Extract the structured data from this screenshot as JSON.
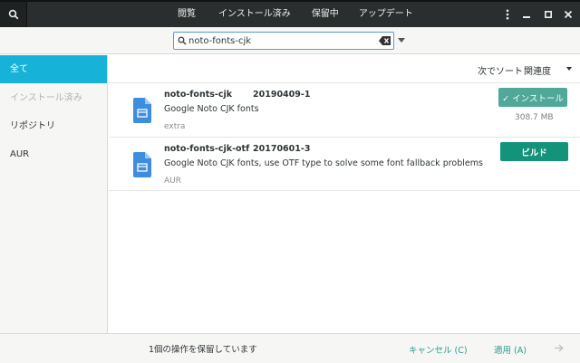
{
  "header": {
    "tabs": [
      {
        "label": "閲覧"
      },
      {
        "label": "インストール済み"
      },
      {
        "label": "保留中"
      },
      {
        "label": "アップデート"
      }
    ],
    "search_toggle_icon": "search-icon",
    "menu_icon": "vertical-dots-icon",
    "window_controls": [
      "minimize-icon",
      "maximize-icon",
      "close-icon"
    ]
  },
  "search": {
    "value": "noto-fonts-cjk",
    "placeholder": ""
  },
  "sidebar": {
    "items": [
      {
        "label": "全て",
        "state": "active"
      },
      {
        "label": "インストール済み",
        "state": "disabled"
      },
      {
        "label": "リポジトリ",
        "state": "normal"
      },
      {
        "label": "AUR",
        "state": "normal"
      }
    ]
  },
  "sort": {
    "label": "次でソート",
    "selected": "関連度"
  },
  "packages": [
    {
      "name": "noto-fonts-cjk",
      "version": "20190409-1",
      "description": "Google Noto CJK fonts",
      "repo": "extra",
      "action": "✓ インストール",
      "size": "308.7 MB"
    },
    {
      "name": "noto-fonts-cjk-otf",
      "version": "20170601-3",
      "description": "Google Noto CJK fonts, use OTF type to solve some font fallback problems",
      "repo": "AUR",
      "action": "ビルド",
      "size": ""
    }
  ],
  "footer": {
    "pending_text": "1個の操作を保留しています",
    "cancel_label": "キャンセル (C)",
    "apply_label": "適用 (A)"
  },
  "colors": {
    "header_bg": "#2b2e2f",
    "accent_blue": "#17b2d8",
    "action_green": "#14937b",
    "link_teal": "#2a9d8f"
  }
}
